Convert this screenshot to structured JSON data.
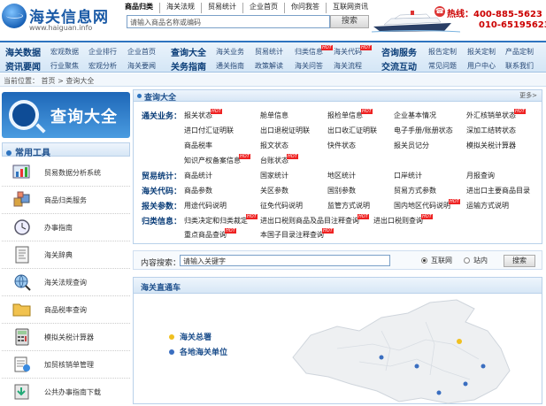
{
  "header": {
    "logo_title": "海关信息网",
    "logo_url": "www.haiguan.info",
    "topnav": [
      "商品归类",
      "海关法规",
      "贸易统计",
      "企业首页",
      "你问我答",
      "互联网资讯"
    ],
    "search_placeholder": "请输入商品名称或编码",
    "search_button": "搜索",
    "hotline_label": "热线：",
    "hotline_1": "400-885-5623",
    "hotline_2": "010-65195623"
  },
  "menu": {
    "row1": [
      "海关数据",
      "宏观数据",
      "企业排行",
      "企业首页",
      "查询大全",
      "海关业务",
      "贸易统计",
      "归类信息",
      "海关代码",
      "咨询服务",
      "报告定制",
      "报关定制",
      "产品定制"
    ],
    "row2": [
      "资讯要闻",
      "行业聚焦",
      "宏观分析",
      "海关要闻",
      "关务指南",
      "通关指南",
      "政策解读",
      "海关问答",
      "海关流程",
      "交流互动",
      "常见问题",
      "用户中心",
      "联系我们"
    ],
    "hot_badge": "HOT"
  },
  "breadcrumb": {
    "label": "当前位置：",
    "home": "首页",
    "sep": ">",
    "current": "查询大全"
  },
  "left": {
    "banner_title": "查询大全",
    "tools_title": "常用工具",
    "tools": [
      "贸易数据分析系统",
      "商品归类服务",
      "办事指南",
      "海关辞典",
      "海关法规查询",
      "商品税率查询",
      "模拟关税计算器",
      "加贸核销单管理",
      "公共办事指南下载"
    ]
  },
  "panel": {
    "title": "查询大全",
    "more": "更多>",
    "categories": [
      {
        "name": "通关业务：",
        "links": [
          "报关状态",
          "舱单信息",
          "报检单信息",
          "企业基本情况",
          "外汇核销单状态",
          "进口付汇证明联",
          "出口退税证明联",
          "出口收汇证明联",
          "电子手册/账册状态",
          "深加工结转状态",
          "商品税率",
          "报文状态",
          "快件状态",
          "报关员记分",
          "模拟关税计算器",
          "知识产权备案信息",
          "台账状态"
        ]
      },
      {
        "name": "贸易统计：",
        "links": [
          "商品统计",
          "国家统计",
          "地区统计",
          "口岸统计",
          "月报查询"
        ]
      },
      {
        "name": "海关代码：",
        "links": [
          "商品参数",
          "关区参数",
          "国别参数",
          "贸易方式参数",
          "进出口主要商品目录"
        ]
      },
      {
        "name": "报关参数：",
        "links": [
          "用途代码说明",
          "征免代码说明",
          "监管方式说明",
          "国内地区代码说明",
          "运输方式说明"
        ]
      },
      {
        "name": "归类信息：",
        "links": [
          "归类决定和归类裁定",
          "进出口税则商品及品目注释查询",
          "进出口税则查询",
          "重点商品查询",
          "本国子目录注释查询"
        ]
      }
    ]
  },
  "content_search": {
    "label": "内容搜索：",
    "value": "请输入关键字",
    "radio_1": "互联网",
    "radio_2": "站内",
    "button": "搜索"
  },
  "map": {
    "title": "海关直通车",
    "legend_1": "海关总署",
    "legend_2": "各地海关单位"
  },
  "colors": {
    "accent": "#2e74c0",
    "hot": "#e22222",
    "hotline": "#cc0000"
  }
}
